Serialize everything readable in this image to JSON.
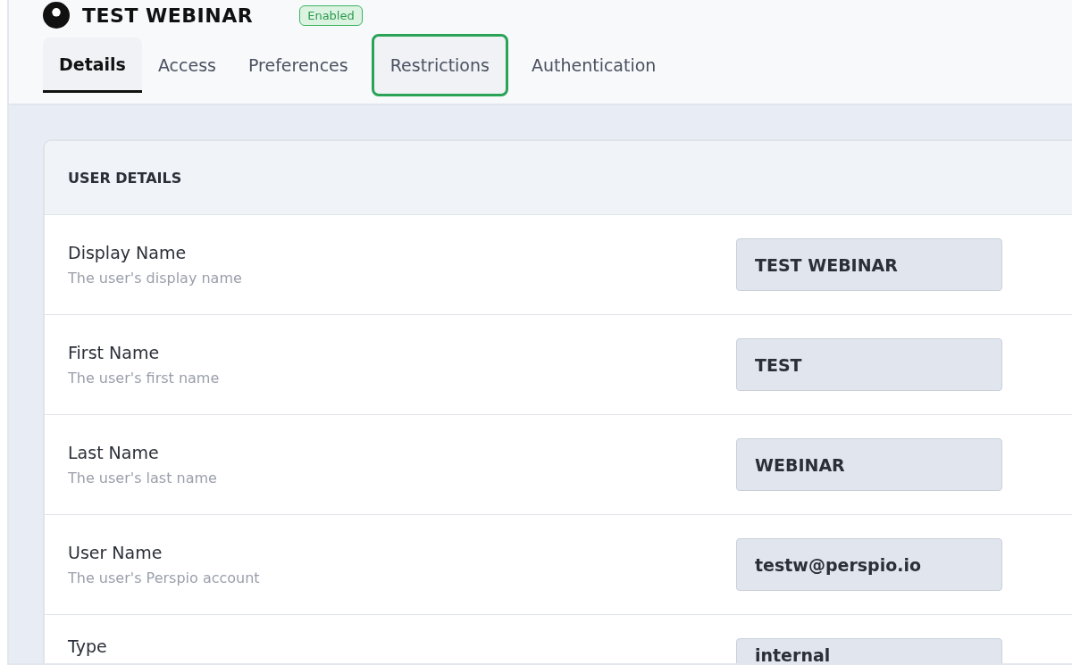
{
  "header": {
    "title": "TEST WEBINAR",
    "badge": "Enabled"
  },
  "tabs": [
    {
      "label": "Details",
      "selected": true,
      "highlighted": false
    },
    {
      "label": "Access",
      "selected": false,
      "highlighted": false
    },
    {
      "label": "Preferences",
      "selected": false,
      "highlighted": false
    },
    {
      "label": "Restrictions",
      "selected": false,
      "highlighted": true
    },
    {
      "label": "Authentication",
      "selected": false,
      "highlighted": false
    }
  ],
  "card": {
    "title": "USER DETAILS",
    "rows": [
      {
        "label": "Display Name",
        "hint": "The user's display name",
        "value": "TEST WEBINAR"
      },
      {
        "label": "First Name",
        "hint": "The user's first name",
        "value": "TEST"
      },
      {
        "label": "Last Name",
        "hint": "The user's last name",
        "value": "WEBINAR"
      },
      {
        "label": "User Name",
        "hint": "The user's Perspio account",
        "value": "testw@perspio.io"
      },
      {
        "label": "Type",
        "value": "internal"
      }
    ]
  }
}
